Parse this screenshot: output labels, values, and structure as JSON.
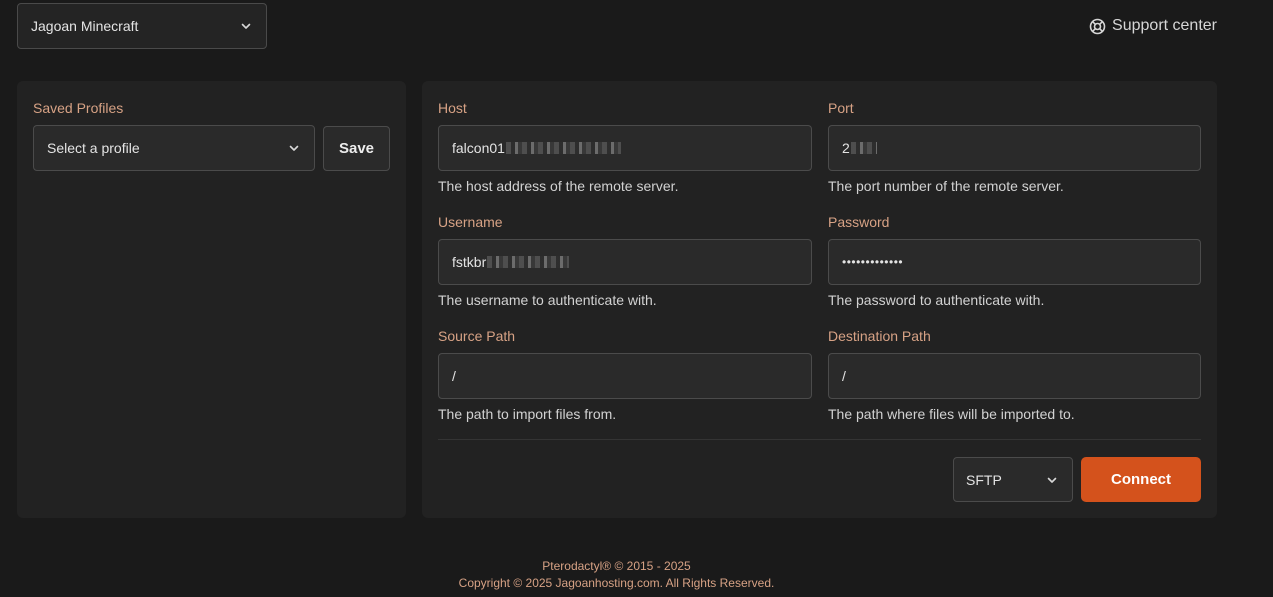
{
  "header": {
    "server_name": "Jagoan Minecraft",
    "support_label": "Support center"
  },
  "profiles": {
    "label": "Saved Profiles",
    "select_value": "Select a profile",
    "save_label": "Save"
  },
  "form": {
    "host": {
      "label": "Host",
      "value": "falcon01",
      "help": "The host address of the remote server."
    },
    "port": {
      "label": "Port",
      "value": "2",
      "help": "The port number of the remote server."
    },
    "username": {
      "label": "Username",
      "value": "fstkbr",
      "help": "The username to authenticate with."
    },
    "password": {
      "label": "Password",
      "value": "•••••••••••••",
      "help": "The password to authenticate with."
    },
    "source": {
      "label": "Source Path",
      "value": "/",
      "help": "The path to import files from."
    },
    "destination": {
      "label": "Destination Path",
      "value": "/",
      "help": "The path where files will be imported to."
    },
    "protocol": "SFTP",
    "connect_label": "Connect"
  },
  "footer": {
    "line1": "Pterodactyl® © 2015 - 2025",
    "line2": "Copyright © 2025 Jagoanhosting.com. All Rights Reserved."
  },
  "colors": {
    "accent": "#d4521c",
    "label": "#d7a285",
    "background": "#1a1a1a",
    "card": "#222222"
  }
}
